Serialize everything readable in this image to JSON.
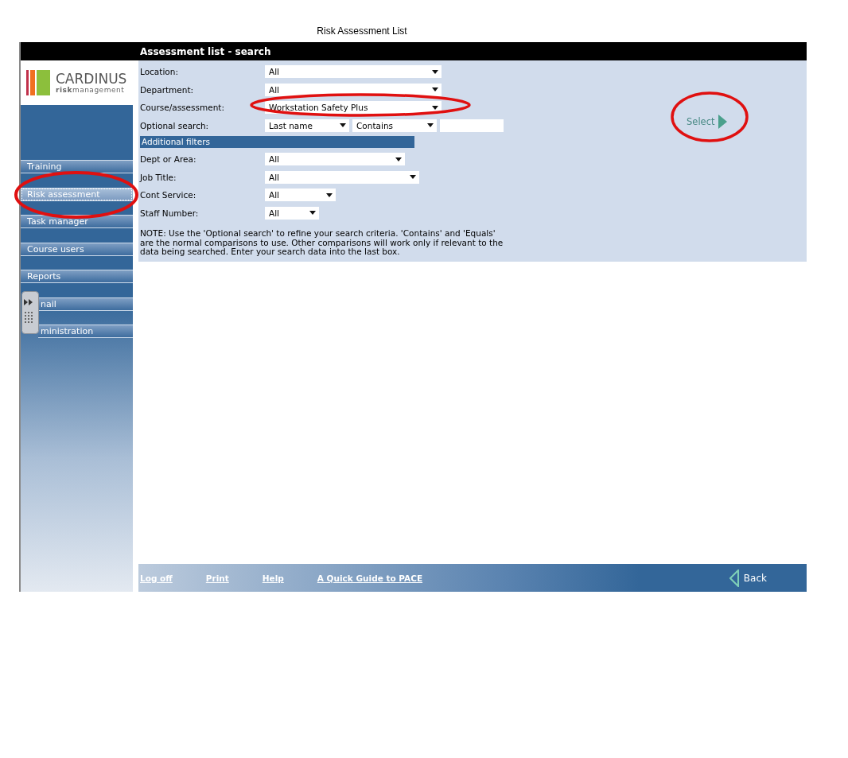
{
  "page_title": "Risk Assessment List",
  "header": {
    "title": "Assessment list - search"
  },
  "logo": {
    "name": "CARDINUS",
    "tagline": "**risk**management"
  },
  "sidebar": {
    "items": [
      {
        "label": "Training",
        "selected": false
      },
      {
        "label": "Risk assessment",
        "selected": true
      },
      {
        "label": "Task manager",
        "selected": false
      },
      {
        "label": "Course users",
        "selected": false
      },
      {
        "label": "Reports",
        "selected": false
      },
      {
        "label": "nail",
        "selected": false
      },
      {
        "label": "ministration",
        "selected": false
      }
    ]
  },
  "form": {
    "fields": [
      {
        "label": "Location:",
        "controls": [
          {
            "kind": "select",
            "value": "All"
          }
        ]
      },
      {
        "label": "Department:",
        "controls": [
          {
            "kind": "select",
            "value": "All"
          }
        ]
      },
      {
        "label": "Course/assessment:",
        "controls": [
          {
            "kind": "select",
            "value": "Workstation Safety Plus"
          }
        ]
      },
      {
        "label": "Optional search:",
        "controls": [
          {
            "kind": "select",
            "value": "Last name"
          },
          {
            "kind": "select",
            "value": "Contains"
          },
          {
            "kind": "text"
          }
        ]
      }
    ],
    "section_title": "Additional filters",
    "filters": [
      {
        "label": "Dept or Area:",
        "controls": [
          {
            "kind": "select",
            "value": "All"
          }
        ]
      },
      {
        "label": "Job Title:",
        "controls": [
          {
            "kind": "select",
            "value": "All"
          }
        ]
      },
      {
        "label": "Cont Service:",
        "controls": [
          {
            "kind": "select",
            "value": "All"
          }
        ]
      },
      {
        "label": "Staff Number:",
        "controls": [
          {
            "kind": "select",
            "value": "All"
          }
        ]
      }
    ],
    "note": "NOTE: Use the 'Optional search' to refine your search criteria. 'Contains' and 'Equals' are the normal comparisons to use. Other comparisons will work only if relevant to the data being searched. Enter your search data into the last box.",
    "select_button": "Select"
  },
  "footer": {
    "links": [
      "Log off",
      "Print",
      "Help",
      "A Quick Guide to PACE"
    ],
    "back": "Back"
  }
}
